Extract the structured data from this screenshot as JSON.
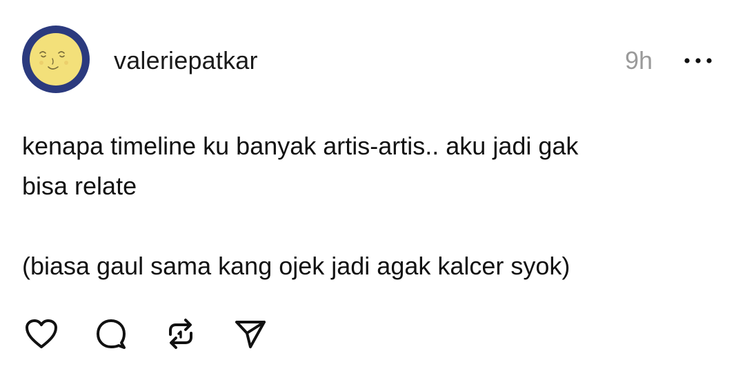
{
  "post": {
    "author": {
      "username": "valeriepatkar",
      "avatar_icon": "sleepy-moon-face-avatar",
      "avatar_bg_color": "#2b3a7e",
      "avatar_face_color": "#f3e07a"
    },
    "timestamp": "9h",
    "more_icon": "more-horizontal-icon",
    "text": {
      "line1": "kenapa timeline ku banyak artis-artis.. aku jadi gak",
      "line2": "bisa relate",
      "line3": "(biasa gaul sama kang ojek jadi agak kalcer syok)"
    },
    "actions": [
      {
        "name": "like",
        "icon": "heart-icon"
      },
      {
        "name": "reply",
        "icon": "comment-icon"
      },
      {
        "name": "repost",
        "icon": "repost-icon"
      },
      {
        "name": "share",
        "icon": "send-icon"
      }
    ]
  }
}
